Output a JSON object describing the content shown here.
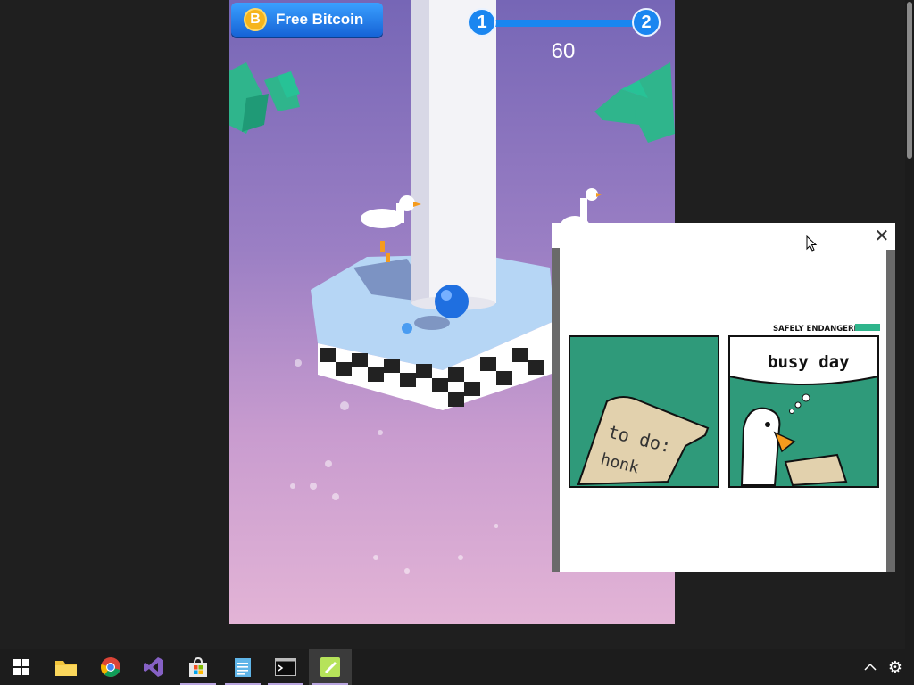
{
  "game": {
    "free_bitcoin_label": "Free Bitcoin",
    "coin_symbol": "B",
    "level_current": "1",
    "level_next": "2",
    "score": "60"
  },
  "ad": {
    "close_symbol": "✕",
    "brand": "SAFELY ENDANGERED",
    "panel_left_text_line1": "to do:",
    "panel_left_text_line2": "honk",
    "panel_right_text": "busy day"
  },
  "taskbar": {
    "items": [
      "start",
      "file-explorer",
      "chrome",
      "visual-studio",
      "microsoft-store",
      "notepad",
      "terminal",
      "game-app"
    ],
    "tray_chevron": "^",
    "settings_symbol": "⚙"
  },
  "colors": {
    "accent_blue": "#1a86f0",
    "ad_green": "#2f9a7a",
    "taskbar_bg": "#1c1c1c"
  }
}
